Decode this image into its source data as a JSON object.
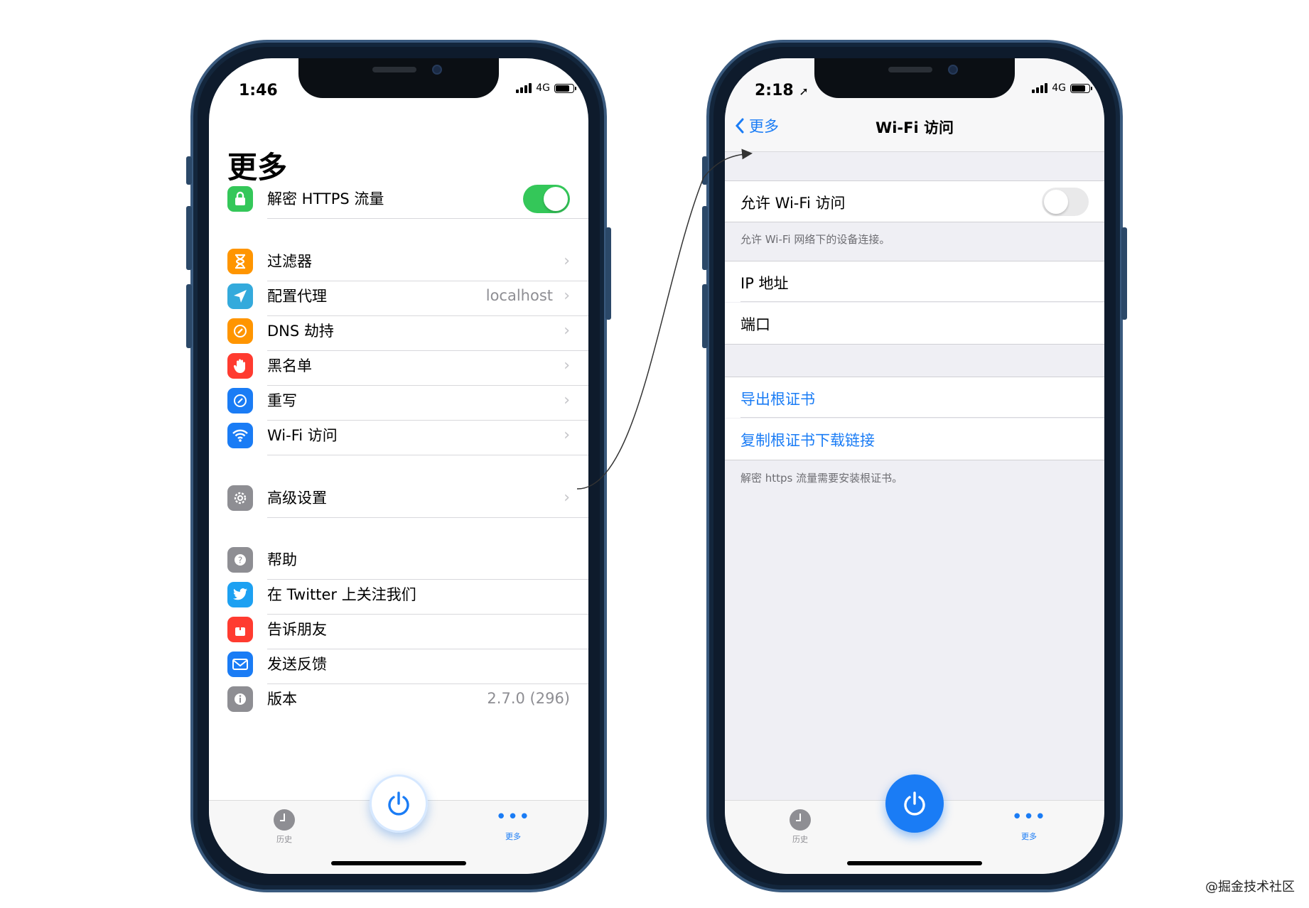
{
  "left_screen": {
    "status": {
      "time": "1:46",
      "network": "4G"
    },
    "title": "更多",
    "rows": [
      {
        "label": "解密 HTTPS 流量",
        "icon": "lock-icon",
        "color": "#34c759"
      },
      {
        "label": "过滤器",
        "icon": "hourglass-icon",
        "color": "#ff9500"
      },
      {
        "label": "配置代理",
        "value": "localhost",
        "icon": "paper-plane-icon",
        "color": "#34aadc"
      },
      {
        "label": "DNS 劫持",
        "icon": "link-icon",
        "color": "#ff9500"
      },
      {
        "label": "黑名单",
        "icon": "hand-icon",
        "color": "#ff3b30"
      },
      {
        "label": "重写",
        "icon": "compass-icon",
        "color": "#1a7cf5"
      },
      {
        "label": "Wi-Fi 访问",
        "icon": "wifi-icon",
        "color": "#1a7cf5"
      },
      {
        "label": "高级设置",
        "icon": "gear-icon",
        "color": "#8e8e93"
      },
      {
        "label": "帮助",
        "icon": "question-icon",
        "color": "#8e8e93"
      },
      {
        "label": "在 Twitter 上关注我们",
        "icon": "twitter-icon",
        "color": "#1da1f2"
      },
      {
        "label": "告诉朋友",
        "icon": "share-icon",
        "color": "#ff3b30"
      },
      {
        "label": "发送反馈",
        "icon": "envelope-icon",
        "color": "#1a7cf5"
      },
      {
        "label": "版本",
        "value": "2.7.0 (296)",
        "icon": "info-icon",
        "color": "#8e8e93"
      }
    ],
    "https_toggle_on": true,
    "tabbar": {
      "history": "历史",
      "more": "更多"
    }
  },
  "right_screen": {
    "status": {
      "time": "2:18",
      "network": "4G"
    },
    "nav": {
      "back": "更多",
      "title": "Wi-Fi 访问"
    },
    "allow_wifi": {
      "label": "允许 Wi-Fi 访问",
      "on": false
    },
    "allow_note": "允许 Wi-Fi 网络下的设备连接。",
    "ip_label": "IP 地址",
    "port_label": "端口",
    "export_cert": "导出根证书",
    "copy_cert_link": "复制根证书下载链接",
    "cert_note": "解密 https 流量需要安装根证书。",
    "tabbar": {
      "history": "历史",
      "more": "更多"
    }
  },
  "watermark": "@掘金技术社区",
  "colors": {
    "accent": "#1a7cf5",
    "toggle_on": "#34c759",
    "frame": "#0e1b2c"
  }
}
